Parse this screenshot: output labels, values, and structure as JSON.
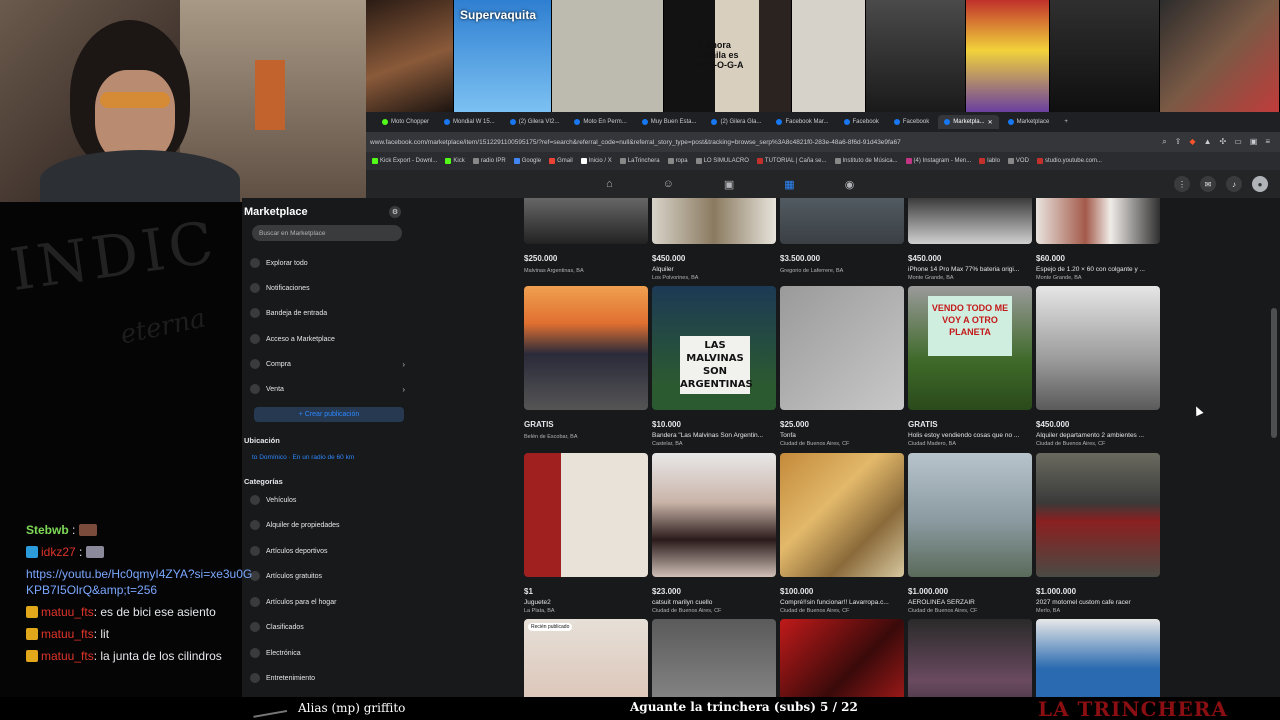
{
  "browser": {
    "url": "www.facebook.com/marketplace/item/1512291100595175/?ref=search&referral_code=null&referral_story_type=post&tracking=browse_serp%3A8c4821f0-283e-48a6-8f6d-91d43e9fa67",
    "tabs": [
      "Moto Chopper",
      "Mondial W 15...",
      "(2) Gilera VI2...",
      "Moto En Perm...",
      "Muy Buen Esta...",
      "(2) Gilera Gla...",
      "Facebook Mar...",
      "Facebook",
      "Facebook",
      "Marketpla...",
      "Marketplace"
    ],
    "bookmarks": [
      "Kick Export - Downl...",
      "Kick",
      "radio IPR",
      "Google",
      "Gmail",
      "Inicio / X",
      "LaTrinchera",
      "ropa",
      "LO SIMULACRO",
      "TUTORIAL | Caña se...",
      "Instituto de Música...",
      "(4) Instagram - Men...",
      "lablo",
      "VOD",
      "studio.youtube.com..."
    ]
  },
  "strip": {
    "labels": [
      "",
      "Supervaquita",
      "",
      "Y ahora camila es A-B-O-G-A",
      "",
      "",
      "",
      "",
      ""
    ]
  },
  "sidebar": {
    "title": "Marketplace",
    "search_placeholder": "Buscar en Marketplace",
    "items": [
      "Explorar todo",
      "Notificaciones",
      "Bandeja de entrada",
      "Acceso a Marketplace",
      "Compra",
      "Venta"
    ],
    "create_label": "Crear publicación",
    "location_heading": "Ubicación",
    "location_value": "to Domínico · En un radio de 60 km",
    "categories_heading": "Categorías",
    "categories": [
      "Vehículos",
      "Alquiler de propiedades",
      "Artículos deportivos",
      "Artículos gratuitos",
      "Artículos para el hogar",
      "Clasificados",
      "Electrónica",
      "Entretenimiento"
    ]
  },
  "listings": [
    {
      "price": "$250.000",
      "title": "",
      "location": "Malvinas Argentinas, BA"
    },
    {
      "price": "$450.000",
      "title": "Alquiler",
      "location": "Los Polvorines, BA"
    },
    {
      "price": "$3.500.000",
      "title": "",
      "location": "Gregorio de Laferrere, BA"
    },
    {
      "price": "$450.000",
      "title": "iPhone 14 Pro Max 77% bateria origi...",
      "location": "Monte Grande, BA"
    },
    {
      "price": "$60.000",
      "title": "Espejo de 1.20 × 60 con colgante y ...",
      "location": "Monte Grande, BA"
    },
    {
      "price": "GRATIS",
      "title": "",
      "location": "Belén de Escobar, BA"
    },
    {
      "price": "$10.000",
      "title": "Bandera \"Las Malvinas Son Argentin...",
      "location": "Castelar, BA"
    },
    {
      "price": "$25.000",
      "title": "Tonfa",
      "location": "Ciudad de Buenos Aires, CF"
    },
    {
      "price": "GRATIS",
      "title": "Holis estoy vendiendo cosas que no ...",
      "location": "Ciudad Madero, BA"
    },
    {
      "price": "$450.000",
      "title": "Alquiler departamento 2 ambientes ...",
      "location": "Ciudad de Buenos Aires, CF"
    },
    {
      "price": "$1",
      "title": "Juguete2",
      "location": "La Plata, BA"
    },
    {
      "price": "$23.000",
      "title": "catsuit marilyn cuello",
      "location": "Ciudad de Buenos Aires, CF"
    },
    {
      "price": "$100.000",
      "title": "Compré!!sin funcionar!! Lavarropa.c...",
      "location": "Ciudad de Buenos Aires, CF"
    },
    {
      "price": "$1.000.000",
      "title": "AEROLINEA SERZAIR",
      "location": "Ciudad de Buenos Aires, CF"
    },
    {
      "price": "$1.000.000",
      "title": "2027 motomel custom cafe racer",
      "location": "Merlo, BA"
    }
  ],
  "images": {
    "malvinas_sign": "LAS MALVINAS SON ARGENTINAS",
    "vendo_sign": "VENDO TODO ME VOY A OTRO PLANETA",
    "recien_tag": "Recién publicado"
  },
  "chat": [
    {
      "user": "Stebwb",
      "text": "",
      "emote": true
    },
    {
      "user": "idkz27",
      "text": "",
      "emote": true
    },
    {
      "user": "",
      "link": "https://youtu.be/Hc0qmyI4ZYA?si=xe3u0GKPB7I5OlrQ&amp;t=256"
    },
    {
      "user": "matuu_fts",
      "text": ": es de bici ese asiento"
    },
    {
      "user": "matuu_fts",
      "text": ": lit"
    },
    {
      "user": "matuu_fts",
      "text": ": la junta de los cilindros"
    }
  ],
  "overlay": {
    "bg_text": "INDIC",
    "bg_text2": "eterna",
    "alias": "Alias (mp) griffito",
    "aguante": "Aguante la trinchera (subs) 5 / 22",
    "brand": "LA TRINCHERA"
  }
}
